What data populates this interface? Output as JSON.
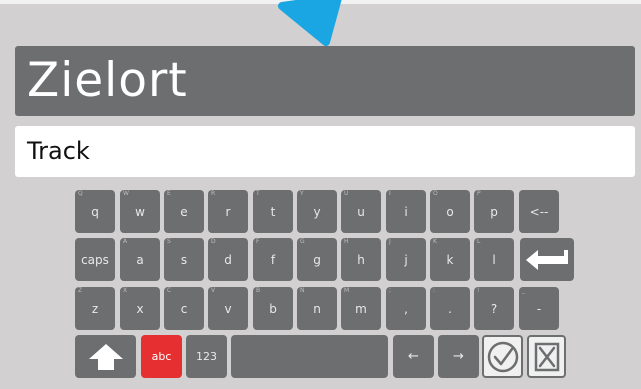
{
  "header": {
    "title": "Zielort",
    "input_value": "Track"
  },
  "keyboard": {
    "row1": [
      {
        "label": "q",
        "hint": "Q"
      },
      {
        "label": "w",
        "hint": "W"
      },
      {
        "label": "e",
        "hint": "E"
      },
      {
        "label": "r",
        "hint": "R"
      },
      {
        "label": "t",
        "hint": "T"
      },
      {
        "label": "y",
        "hint": "Y"
      },
      {
        "label": "u",
        "hint": "U"
      },
      {
        "label": "i",
        "hint": "I"
      },
      {
        "label": "o",
        "hint": "O"
      },
      {
        "label": "p",
        "hint": "P"
      },
      {
        "label": "<--",
        "hint": ""
      }
    ],
    "row2": [
      {
        "label": "caps",
        "hint": ""
      },
      {
        "label": "a",
        "hint": "A"
      },
      {
        "label": "s",
        "hint": "S"
      },
      {
        "label": "d",
        "hint": "D"
      },
      {
        "label": "f",
        "hint": "F"
      },
      {
        "label": "g",
        "hint": "G"
      },
      {
        "label": "h",
        "hint": "H"
      },
      {
        "label": "j",
        "hint": "J"
      },
      {
        "label": "k",
        "hint": "K"
      },
      {
        "label": "l",
        "hint": "L"
      }
    ],
    "row3": [
      {
        "label": "z",
        "hint": "Z"
      },
      {
        "label": "x",
        "hint": "X"
      },
      {
        "label": "c",
        "hint": "C"
      },
      {
        "label": "v",
        "hint": "V"
      },
      {
        "label": "b",
        "hint": "B"
      },
      {
        "label": "n",
        "hint": "N"
      },
      {
        "label": "m",
        "hint": "M"
      },
      {
        "label": ",",
        "hint": ";"
      },
      {
        "label": ".",
        "hint": ":"
      },
      {
        "label": "?",
        "hint": "!"
      },
      {
        "label": "-",
        "hint": "_"
      }
    ],
    "row4": {
      "abc_label": "abc",
      "num_label": "123",
      "left_arrow": "←",
      "right_arrow": "→"
    }
  },
  "colors": {
    "background": "#d3d0d1",
    "key": "#6d6e70",
    "abc_active": "#e52f31",
    "pointer": "#1aa5e3"
  },
  "icons": [
    "shift-icon",
    "enter-icon",
    "confirm-check-icon",
    "cancel-x-icon",
    "pointer-arrow-icon"
  ]
}
